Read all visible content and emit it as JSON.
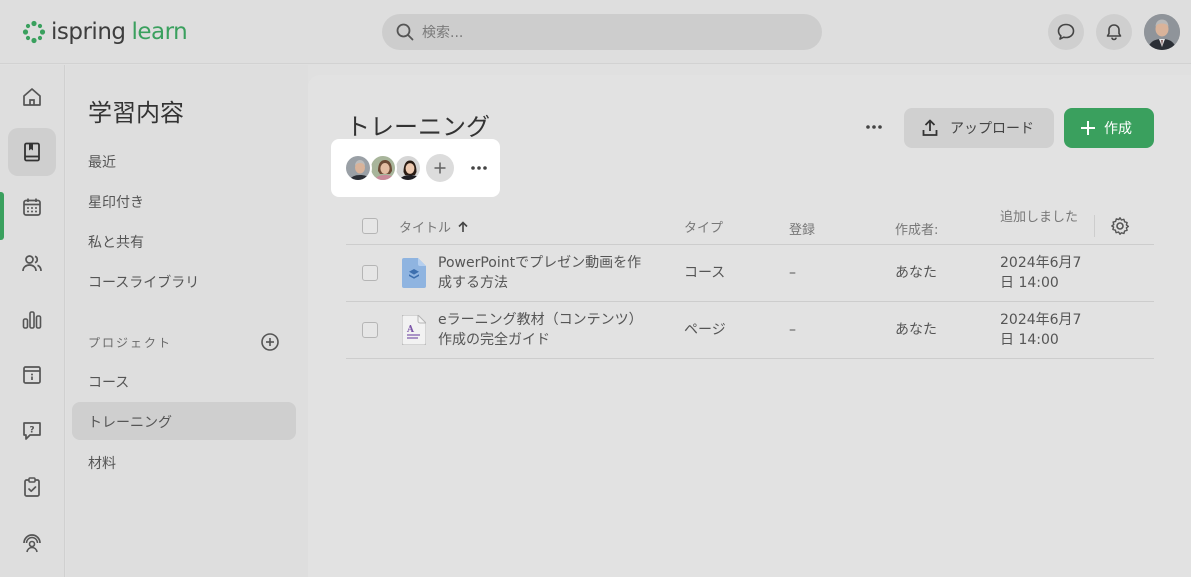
{
  "header": {
    "logo_part1": "ispring",
    "logo_part2": "learn",
    "search_placeholder": "検索...",
    "icons": [
      "search-icon",
      "chat-icon",
      "bell-icon",
      "user-avatar"
    ]
  },
  "rail": {
    "icons": [
      "home-icon",
      "book-icon",
      "calendar-icon",
      "users-icon",
      "chart-icon",
      "info-icon",
      "help-icon",
      "clipboard-icon",
      "support-icon"
    ],
    "active_index": 1
  },
  "nav": {
    "title": "学習内容",
    "items": [
      "最近",
      "星印付き",
      "私と共有",
      "コースライブラリ"
    ],
    "section_label": "プロジェクト",
    "project_items": [
      "コース",
      "トレーニング",
      "材料"
    ],
    "active_project_index": 1
  },
  "main": {
    "title": "トレーニング",
    "upload_label": "アップロード",
    "create_label": "作成"
  },
  "table": {
    "columns": [
      "タイトル",
      "タイプ",
      "登録",
      "作成者:",
      "追加しました"
    ],
    "rows": [
      {
        "title_line1": "PowerPointでプレゼン動画を作",
        "title_line2": "成する方法",
        "type": "コース",
        "enrolled": "–",
        "author": "あなた",
        "added_line1": "2024年6月7",
        "added_line2": "日 14:00",
        "icon": "course-icon"
      },
      {
        "title_line1": "eラーニング教材（コンテンツ）",
        "title_line2": "作成の完全ガイド",
        "type": "ページ",
        "enrolled": "–",
        "author": "あなた",
        "added_line1": "2024年6月7",
        "added_line2": "日 14:00",
        "icon": "page-icon"
      }
    ]
  },
  "colors": {
    "accent": "#3aa05e",
    "background": "#e0e0e0",
    "member_panel": "#ffffff"
  }
}
